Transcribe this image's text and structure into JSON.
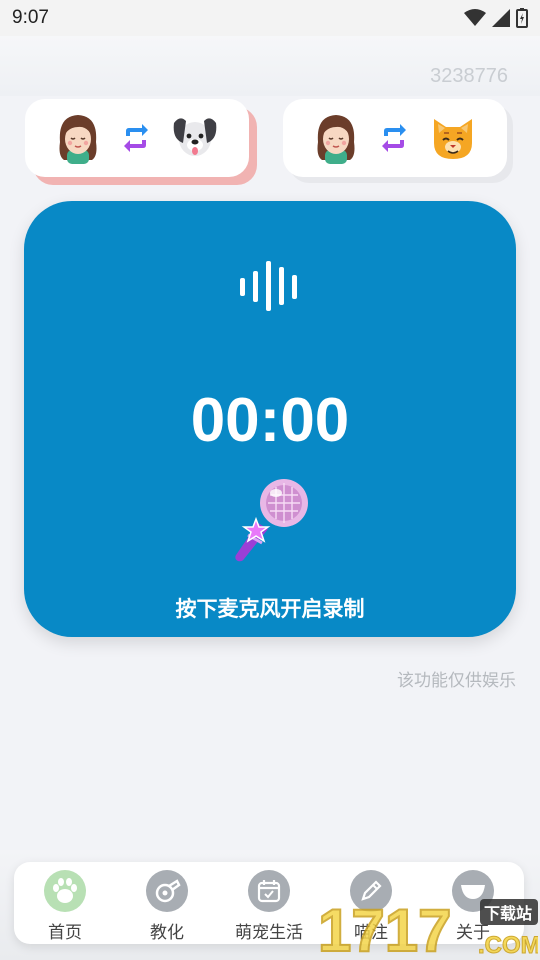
{
  "status_bar": {
    "time": "9:07"
  },
  "counter": "3238776",
  "modes": [
    {
      "from": "girl-avatar",
      "swap": "swap-arrows-icon",
      "to": "dog-face",
      "active": true
    },
    {
      "from": "girl-avatar",
      "swap": "swap-arrows-icon",
      "to": "cat-face",
      "active": false
    }
  ],
  "recorder": {
    "timer": "00:00",
    "hint": "按下麦克风开启录制",
    "icon": "sound-wave-icon",
    "mic_icon": "microphone-icon"
  },
  "disclaimer": "该功能仅供娱乐",
  "tabs": [
    {
      "label": "首页",
      "icon": "paw-icon",
      "active": true
    },
    {
      "label": "教化",
      "icon": "whistle-icon",
      "active": false
    },
    {
      "label": "萌宠生活",
      "icon": "calendar-icon",
      "active": false
    },
    {
      "label": "喵注",
      "icon": "pen-icon",
      "active": false
    },
    {
      "label": "关于",
      "icon": "about-icon",
      "active": false
    }
  ],
  "watermark": {
    "text": "1717",
    "sub": "下载站",
    "domain": ".COM"
  },
  "colors": {
    "accent": "#0889c6",
    "active_shadow": "#f1b3b2",
    "active_tab": "#b8e0b4"
  }
}
